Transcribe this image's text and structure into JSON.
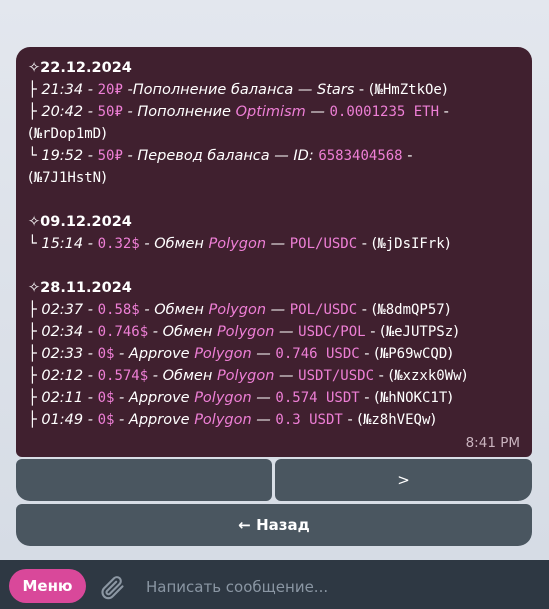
{
  "message": {
    "groups": [
      {
        "date": "✧22.12.2024",
        "rows": [
          {
            "prefix": " ├ ",
            "time": "21:34",
            "sep1": " - ",
            "amount": "20₽",
            "sep2": " -",
            "desc": "Пополнение баланса",
            "dash": " — ",
            "asset": "Stars",
            "sep3": " - (",
            "ref": "№HmZtkOe",
            "close": ")"
          },
          {
            "prefix": " ├ ",
            "time": "20:42",
            "sep1": " - ",
            "amount": "50₽",
            "sep2": " - ",
            "desc": "Пополнение",
            "net": "Optimism",
            "dash": " — ",
            "value": "0.0001235 ETH",
            "sep3": " -",
            "wrap": "(",
            "ref": "№rDop1mD",
            "close": ")"
          },
          {
            "prefix": " └ ",
            "time": "19:52",
            "sep1": " - ",
            "amount": "50₽",
            "sep2": " -  ",
            "desc": "Перевод баланса — ID:",
            "id": "6583404568",
            "sep3": " -",
            "wrap": "(",
            "ref": "№7J1HstN",
            "close": ")"
          }
        ]
      },
      {
        "date": "✧09.12.2024",
        "rows": [
          {
            "prefix": " └ ",
            "time": "15:14",
            "sep1": " - ",
            "amount": "0.32$",
            "sep2": " -  ",
            "desc": "Обмен",
            "net": "Polygon",
            "dash": " — ",
            "value": "POL/USDC",
            "sep3": " - (",
            "ref": "№jDsIFrk",
            "close": ")"
          }
        ]
      },
      {
        "date": "✧28.11.2024",
        "rows": [
          {
            "prefix": " ├ ",
            "time": "02:37",
            "sep1": " - ",
            "amount": "0.58$",
            "sep2": " - ",
            "desc": "Обмен",
            "net": "Polygon",
            "dash": " — ",
            "value": "POL/USDC",
            "sep3": " - (",
            "ref": "№8dmQP57",
            "close": ")"
          },
          {
            "prefix": " ├ ",
            "time": "02:34",
            "sep1": " - ",
            "amount": "0.746$",
            "sep2": " - ",
            "desc": "Обмен",
            "net": "Polygon",
            "dash": " — ",
            "value": "USDC/POL",
            "sep3": " - (",
            "ref": "№eJUTPSz",
            "close": ")"
          },
          {
            "prefix": " ├ ",
            "time": "02:33",
            "sep1": " - ",
            "amount": "0$",
            "sep2": " - ",
            "desc": "Approve",
            "net": "Polygon",
            "dash": " — ",
            "value": "0.746 USDC",
            "sep3": " - (",
            "ref": "№P69wCQD",
            "close": ")"
          },
          {
            "prefix": " ├ ",
            "time": "02:12",
            "sep1": " - ",
            "amount": "0.574$",
            "sep2": " - ",
            "desc": "Обмен",
            "net": "Polygon",
            "dash": " — ",
            "value": "USDT/USDC",
            "sep3": " - (",
            "ref": "№xzxk0Ww",
            "close": ")"
          },
          {
            "prefix": " ├ ",
            "time": "02:11",
            "sep1": " - ",
            "amount": "0$",
            "sep2": " - ",
            "desc": "Approve",
            "net": "Polygon",
            "dash": " — ",
            "value": "0.574 USDT",
            "sep3": " - (",
            "ref": "№hNOKC1T",
            "close": ")"
          },
          {
            "prefix": " ├ ",
            "time": "01:49",
            "sep1": " - ",
            "amount": "0$",
            "sep2": " - ",
            "desc": "Approve",
            "net": "Polygon",
            "dash": " — ",
            "value": "0.3 USDT",
            "sep3": " - (",
            "ref": "№z8hVEQw",
            "close": ")"
          }
        ]
      }
    ],
    "sent_time": "8:41 PM"
  },
  "keyboard": {
    "left_label": "",
    "right_label": ">",
    "back_label": "← Назад"
  },
  "composer": {
    "menu_label": "Меню",
    "placeholder": "Написать сообщение..."
  },
  "icons": {
    "attach": "paperclip-icon"
  },
  "colors": {
    "bubble": "#40202f",
    "accent_pink": "#ee7fd6",
    "menu_button": "#d9489a",
    "keyboard_button": "#4a5660",
    "bottom_bar": "#2e3843"
  }
}
